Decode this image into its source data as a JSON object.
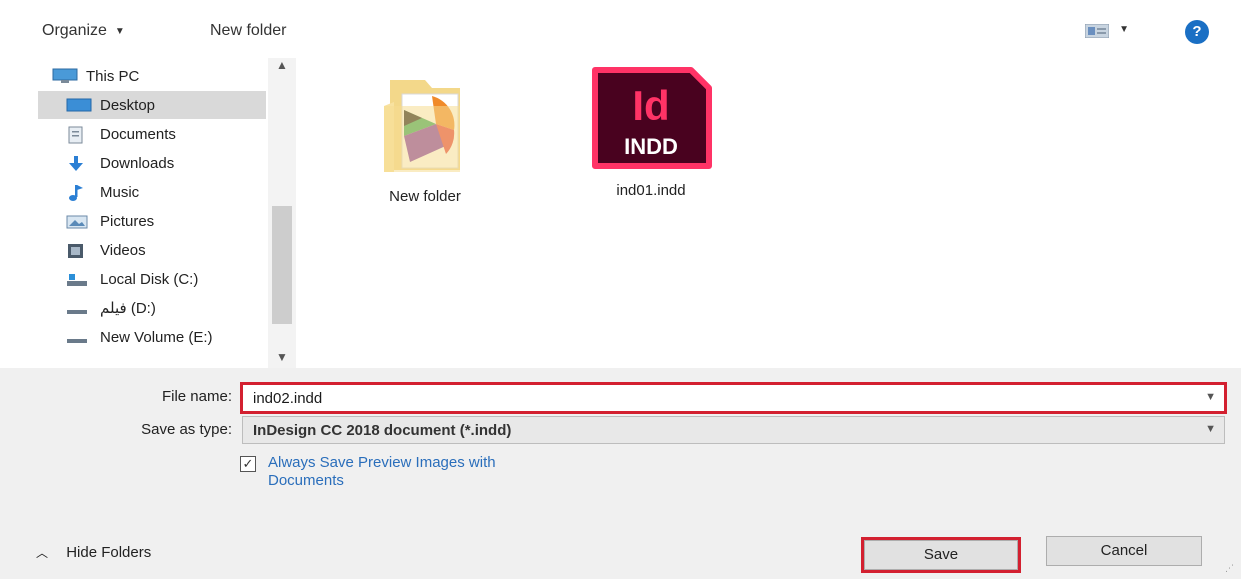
{
  "toolbar": {
    "organize_label": "Organize",
    "new_folder_label": "New folder"
  },
  "nav": {
    "items": [
      {
        "label": "This PC",
        "icon": "pc-icon"
      },
      {
        "label": "Desktop",
        "icon": "desktop-icon",
        "selected": true
      },
      {
        "label": "Documents",
        "icon": "documents-icon"
      },
      {
        "label": "Downloads",
        "icon": "downloads-icon"
      },
      {
        "label": "Music",
        "icon": "music-icon"
      },
      {
        "label": "Pictures",
        "icon": "pictures-icon"
      },
      {
        "label": "Videos",
        "icon": "videos-icon"
      },
      {
        "label": "Local Disk (C:)",
        "icon": "drive-icon"
      },
      {
        "label": "فيلم (D:)",
        "icon": "drive-icon"
      },
      {
        "label": "New Volume (E:)",
        "icon": "drive-icon"
      }
    ]
  },
  "files": [
    {
      "name": "New folder",
      "type": "folder"
    },
    {
      "name": "ind01.indd",
      "type": "indd",
      "icon_text_top": "Id",
      "icon_text_bottom": "INDD"
    }
  ],
  "form": {
    "file_name_label": "File name:",
    "file_name_value": "ind02.indd",
    "save_type_label": "Save as type:",
    "save_type_value": "InDesign CC 2018 document (*.indd)",
    "preview_checked": true,
    "preview_label": "Always Save Preview Images with Documents"
  },
  "footer": {
    "hide_folders_label": "Hide Folders",
    "save_label": "Save",
    "cancel_label": "Cancel"
  },
  "colors": {
    "highlight_red": "#d32030",
    "indd_pink": "#ff3366",
    "indd_dark": "#49021f",
    "link_blue": "#2a6ebb"
  }
}
